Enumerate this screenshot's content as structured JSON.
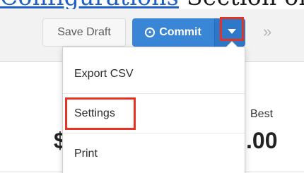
{
  "document": {
    "link_text": "Configurations",
    "trailing_text": " Section of"
  },
  "toolbar": {
    "save_draft_label": "Save Draft",
    "commit_label": "Commit",
    "commit_icon": "upload-circle-icon",
    "caret_icon": "caret-down-icon",
    "more_icon": "double-chevron-right-icon"
  },
  "summary": {
    "left_value_fragment": "$",
    "best_label": "Best",
    "best_value_fragment": ".00"
  },
  "dropdown": {
    "items": [
      {
        "label": "Export CSV"
      },
      {
        "label": "Settings"
      },
      {
        "label": "Print"
      }
    ]
  },
  "colors": {
    "commit_blue": "#3a86d6",
    "highlight_red": "#e53323",
    "link_blue": "#1f5fc7"
  }
}
